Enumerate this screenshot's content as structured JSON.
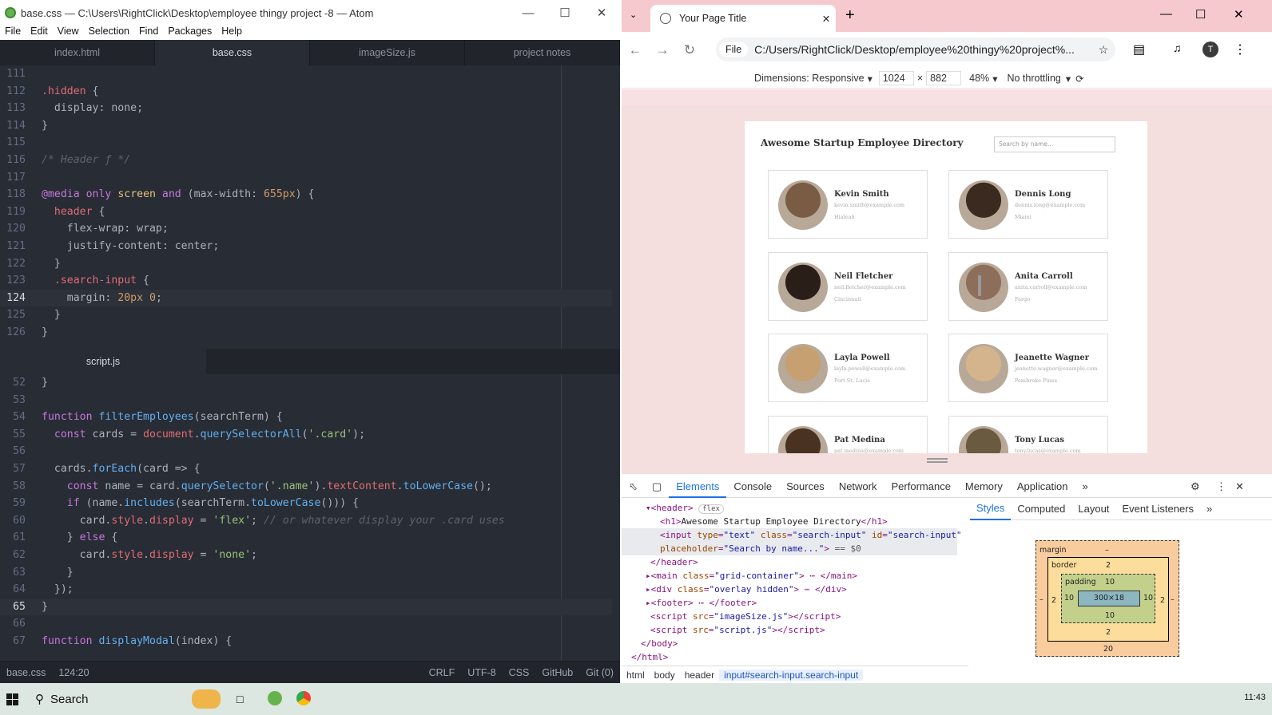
{
  "atom": {
    "window_title": "base.css — C:\\Users\\RightClick\\Desktop\\employee thingy project -8 — Atom",
    "menu": [
      "File",
      "Edit",
      "View",
      "Selection",
      "Find",
      "Packages",
      "Help"
    ],
    "top_tabs": [
      "index.html",
      "base.css",
      "imageSize.js",
      "project notes"
    ],
    "bottom_tab": "script.js",
    "top_lines": [
      {
        "n": "111",
        "html": ""
      },
      {
        "n": "112",
        "html": "<span class='r'>.hidden</span> {"
      },
      {
        "n": "113",
        "html": "  <span class='tx2'>display</span>: none;"
      },
      {
        "n": "114",
        "html": "}"
      },
      {
        "n": "115",
        "html": ""
      },
      {
        "n": "116",
        "html": "<span class='c'>/* Header ƒ */</span>"
      },
      {
        "n": "117",
        "html": ""
      },
      {
        "n": "118",
        "html": "<span class='k'>@media</span> <span class='k'>only</span> <span class='t'>screen</span> <span class='k'>and</span> (max-width: <span class='n'>655px</span>) {"
      },
      {
        "n": "119",
        "html": "  <span class='r'>header</span> {"
      },
      {
        "n": "120",
        "html": "    flex-wrap: wrap;"
      },
      {
        "n": "121",
        "html": "    justify-content: center;"
      },
      {
        "n": "122",
        "html": "  }"
      },
      {
        "n": "123",
        "html": "  <span class='r'>.search-input</span> {"
      },
      {
        "n": "124",
        "html": "    margin: <span class='n'>20px</span> <span class='n'>0</span>;"
      },
      {
        "n": "125",
        "html": "  }"
      },
      {
        "n": "126",
        "html": "}"
      }
    ],
    "bottom_lines": [
      {
        "n": "52",
        "html": "}"
      },
      {
        "n": "53",
        "html": ""
      },
      {
        "n": "54",
        "html": "<span class='k'>function</span> <span class='f'>filterEmployees</span>(searchTerm) {"
      },
      {
        "n": "55",
        "html": "  <span class='k'>const</span> cards = <span class='r'>document</span>.<span class='f'>querySelectorAll</span>(<span class='s'>'.card'</span>);"
      },
      {
        "n": "56",
        "html": ""
      },
      {
        "n": "57",
        "html": "  cards.<span class='f'>forEach</span>(card =&gt; {"
      },
      {
        "n": "58",
        "html": "    <span class='k'>const</span> name = card.<span class='f'>querySelector</span>(<span class='s'>'.name'</span>).<span class='r'>textContent</span>.<span class='f'>toLowerCase</span>();"
      },
      {
        "n": "59",
        "html": "    <span class='k'>if</span> (name.<span class='f'>includes</span>(searchTerm.<span class='f'>toLowerCase</span>())) {"
      },
      {
        "n": "60",
        "html": "      card.<span class='r'>style</span>.<span class='r'>display</span> = <span class='s'>'flex'</span>; <span class='c'>// or whatever display your .card uses</span>"
      },
      {
        "n": "61",
        "html": "    } <span class='k'>else</span> {"
      },
      {
        "n": "62",
        "html": "      card.<span class='r'>style</span>.<span class='r'>display</span> = <span class='s'>'none'</span>;"
      },
      {
        "n": "63",
        "html": "    }"
      },
      {
        "n": "64",
        "html": "  });"
      },
      {
        "n": "65",
        "html": "}"
      },
      {
        "n": "66",
        "html": ""
      },
      {
        "n": "67",
        "html": "<span class='k'>function</span> <span class='f'>displayModal</span>(index) {"
      }
    ],
    "status": {
      "file": "base.css",
      "cursor": "124:20",
      "eol": "CRLF",
      "enc": "UTF-8",
      "grammar": "CSS",
      "github": "GitHub",
      "git": "Git (0)"
    }
  },
  "chrome": {
    "tab_title": "Your Page Title",
    "url_chip": "File",
    "url": "C:/Users/RightClick/Desktop/employee%20thingy%20project%...",
    "profile_initial": "T",
    "device": {
      "dimensions": "Dimensions: Responsive",
      "width": "1024",
      "height": "882",
      "zoom": "48%",
      "throttle": "No throttling"
    },
    "page": {
      "heading": "Awesome Startup Employee Directory",
      "search_placeholder": "Search by name...",
      "employees": [
        {
          "name": "Kevin Smith",
          "email": "kevin.smith@example.com",
          "city": "Hialeah"
        },
        {
          "name": "Dennis Long",
          "email": "dennis.long@example.com",
          "city": "Miami"
        },
        {
          "name": "Neil Fletcher",
          "email": "neil.fletcher@example.com",
          "city": "Cincinnati"
        },
        {
          "name": "Anita Carroll",
          "email": "anita.carroll@example.com",
          "city": "Fargo"
        },
        {
          "name": "Layla Powell",
          "email": "layla.powell@example.com",
          "city": "Port St. Lucie"
        },
        {
          "name": "Jeanette Wagner",
          "email": "jeanette.wagner@example.com",
          "city": "Pembroke Pines"
        },
        {
          "name": "Pat Medina",
          "email": "pat.medina@example.com",
          "city": ""
        },
        {
          "name": "Tony Lucas",
          "email": "tony.lucas@example.com",
          "city": ""
        }
      ]
    },
    "devtools": {
      "tabs": [
        "Elements",
        "Console",
        "Sources",
        "Network",
        "Performance",
        "Memory",
        "Application"
      ],
      "side_tabs": [
        "Styles",
        "Computed",
        "Layout",
        "Event Listeners"
      ],
      "breadcrumbs": [
        "html",
        "body",
        "header",
        "input#search-input.search-input"
      ],
      "boxmodel": {
        "margin_label": "margin",
        "margin_top": "–",
        "border_label": "border",
        "border": "2",
        "padding_label": "padding",
        "padding": "10",
        "content": "300×18",
        "margin_bottom": "20",
        "margin_side": "–"
      }
    }
  },
  "taskbar": {
    "search": "Search",
    "time": "11:43"
  }
}
